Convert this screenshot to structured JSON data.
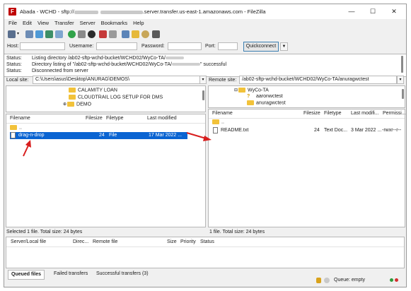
{
  "window": {
    "title_prefix": "Abada - WCHD - sftp://",
    "title_suffix": ".server.transfer.us-east-1.amazonaws.com - FileZilla",
    "app_icon_glyph": "F",
    "minimize": "—",
    "maximize": "☐",
    "close": "✕"
  },
  "menu": [
    "File",
    "Edit",
    "View",
    "Transfer",
    "Server",
    "Bookmarks",
    "Help"
  ],
  "quickconnect": {
    "host_label": "Host:",
    "username_label": "Username:",
    "password_label": "Password:",
    "port_label": "Port:",
    "button": "Quickconnect"
  },
  "log": [
    {
      "label": "Status:",
      "text_a": "Listing directory /ab02-sftp-wchd-bucket/WCHD02/WyCo-TA/",
      "text_b": ""
    },
    {
      "label": "Status:",
      "text_a": "Directory listing of \"/ab02-sftp-wchd-bucket/WCHD02/WyCo-TA/",
      "text_b": "\" successful"
    },
    {
      "label": "Status:",
      "text_a": "Disconnected from server",
      "text_b": ""
    }
  ],
  "local": {
    "site_label": "Local site:",
    "path": "C:\\Users\\asus\\Desktop\\ANURAG\\DEMOS\\",
    "tree": [
      "CALAMITY LOAN",
      "CLOUDTRAIL LOG SETUP FOR DMS",
      "DEMO"
    ],
    "columns": [
      "Filename",
      "Filesize",
      "Filetype",
      "Last modified"
    ],
    "parent_dir": "..",
    "files": [
      {
        "name": "drag-n-drop",
        "size": "24",
        "type": "File",
        "modified": "17 Mar 2022 ..."
      }
    ],
    "status": "Selected 1 file. Total size: 24 bytes"
  },
  "remote": {
    "site_label": "Remote site:",
    "path": "/ab02-sftp-wchd-bucket/WCHD02/WyCo-TA/anuragwctest",
    "tree": [
      "WyCo-TA",
      "aaronwctest",
      "anuragwctest"
    ],
    "columns": [
      "Filename",
      "Filesize",
      "Filetype",
      "Last modifi...",
      "Permissi..."
    ],
    "parent_dir": "..",
    "files": [
      {
        "name": "README.txt",
        "size": "24",
        "type": "Text Doc...",
        "modified": "3 Mar 2022 ...",
        "perms": "-rwxr--r--"
      }
    ],
    "status": "1 file. Total size: 24 bytes"
  },
  "queue": {
    "columns": [
      "Server/Local file",
      "Direc...",
      "Remote file",
      "Size",
      "Priority",
      "Status"
    ],
    "tabs": [
      "Queued files",
      "Failed transfers",
      "Successful transfers (3)"
    ],
    "status": "Queue: empty"
  },
  "colors": {
    "selection": "#0a64d2",
    "annotation_arrow": "#d81e1e",
    "folder": "#f2c23a"
  }
}
